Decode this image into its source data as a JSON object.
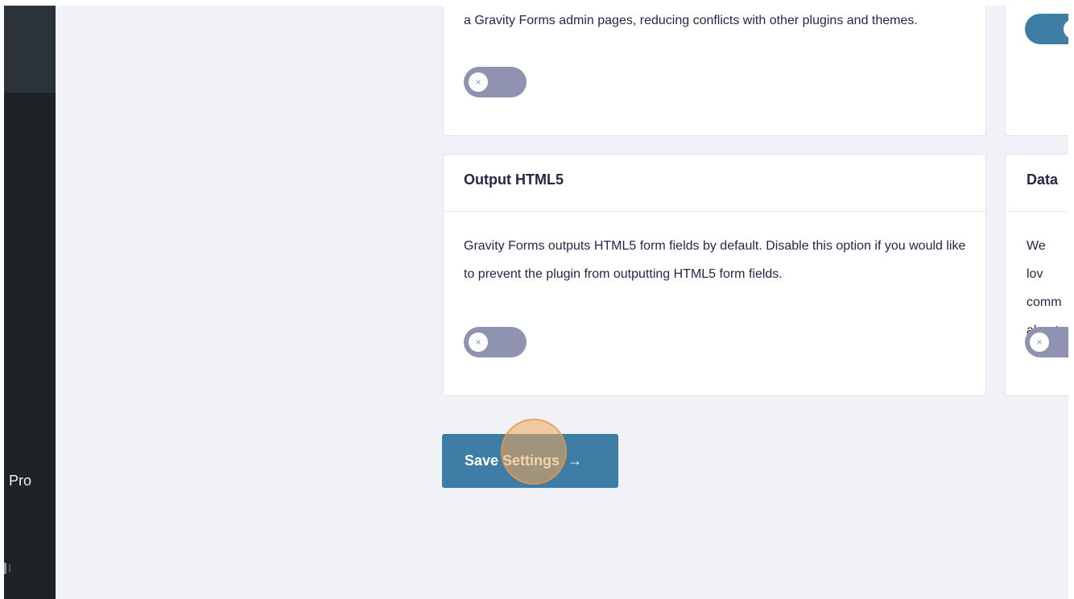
{
  "sidebar": {
    "pro_label": "Pro"
  },
  "cards": {
    "top_left": {
      "description": "a Gravity Forms admin pages, reducing conflicts with other plugins and themes.",
      "toggle_on": false,
      "toggle_icon": "×"
    },
    "top_right": {
      "toggle_on": true,
      "toggle_icon": "✓"
    },
    "output_html5": {
      "title": "Output HTML5",
      "description": "Gravity Forms outputs HTML5 form fields by default. Disable this option if you would like to prevent the plugin from outputting HTML5 form fields.",
      "toggle_on": false,
      "toggle_icon": "×"
    },
    "data_collection": {
      "title": "Data",
      "description": "We lov comm about",
      "toggle_on": false,
      "toggle_icon": "×"
    }
  },
  "save_button": {
    "label": "Save Settings",
    "arrow": "→"
  },
  "colors": {
    "accent": "#3e7da6",
    "toggle_off": "#9092b2",
    "sidebar": "#1d2327",
    "background": "#f0f2f7"
  }
}
